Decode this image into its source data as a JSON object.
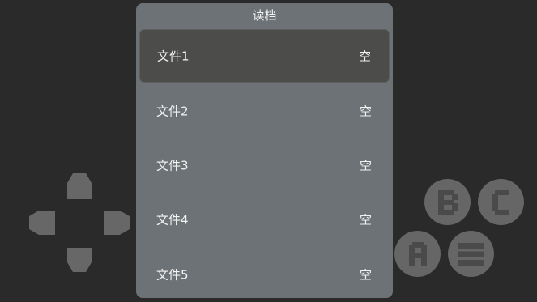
{
  "dialog": {
    "title": "读档",
    "slots": [
      {
        "name": "文件1",
        "status": "空",
        "selected": true
      },
      {
        "name": "文件2",
        "status": "空",
        "selected": false
      },
      {
        "name": "文件3",
        "status": "空",
        "selected": false
      },
      {
        "name": "文件4",
        "status": "空",
        "selected": false
      },
      {
        "name": "文件5",
        "status": "空",
        "selected": false
      }
    ]
  },
  "controls": {
    "dpad_icons": [
      "dpad-up-icon",
      "dpad-down-icon",
      "dpad-left-icon",
      "dpad-right-icon"
    ],
    "buttons": [
      "button-b-icon",
      "button-c-icon",
      "button-a-icon",
      "menu-icon"
    ]
  },
  "colors": {
    "background": "#2a2a2a",
    "dialog": "#6c7275",
    "selected_slot": "#4c4c4a",
    "control": "#666666",
    "text": "#f2f2f2"
  }
}
